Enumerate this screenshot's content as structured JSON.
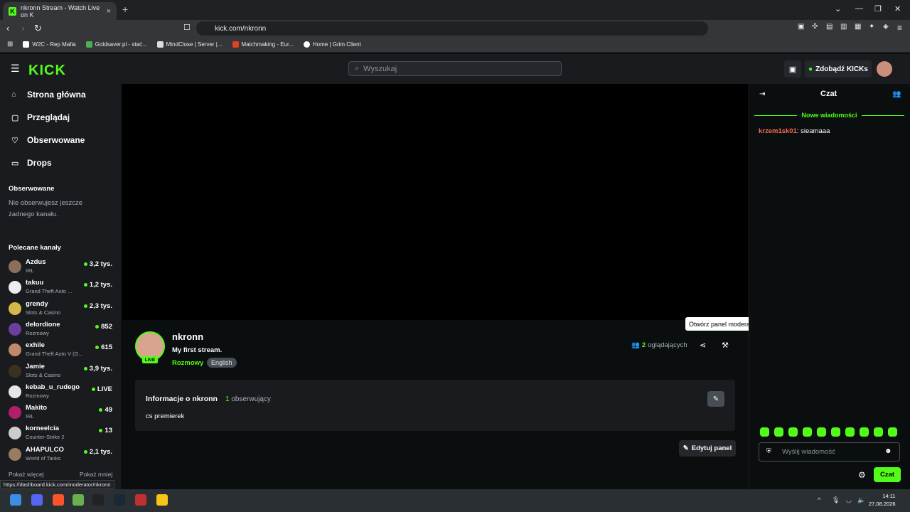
{
  "browser": {
    "tab_title": "nkronn Stream - Watch Live on K",
    "tab_close": "×",
    "new_tab": "+",
    "url": "kick.com/nkronn",
    "bookmarks": [
      "W2C - Rep Mafia",
      "Goldsaver.pl - stać...",
      "MindClose | Server |...",
      "Matchmaking - Eur...",
      "Home | Grim Client"
    ],
    "status_url": "https://dashboard.kick.com/moderator/nkronn"
  },
  "header": {
    "logo": "KICK",
    "search_placeholder": "Wyszukaj",
    "kicks_label": "Zdobądź KICKs"
  },
  "sidebar": {
    "nav": [
      "Strona główna",
      "Przeglądaj",
      "Obserwowane",
      "Drops"
    ],
    "followed_title": "Obserwowane",
    "followed_empty": "Nie obserwujesz jeszcze żadnego kanału.",
    "recommended_title": "Polecane kanały",
    "channels": [
      {
        "name": "Azdus",
        "category": "IRL",
        "viewers": "3,2 tys.",
        "color": "#8a6f5c"
      },
      {
        "name": "takuu",
        "category": "Grand Theft Auto ...",
        "viewers": "1,2 tys.",
        "color": "#eeeeee"
      },
      {
        "name": "grendy",
        "category": "Slots & Casino",
        "viewers": "2,3 tys.",
        "color": "#d4b84a"
      },
      {
        "name": "delordione",
        "category": "Rozmowy",
        "viewers": "852",
        "color": "#6a3fa0"
      },
      {
        "name": "exhile",
        "category": "Grand Theft Auto V (G...",
        "viewers": "615",
        "color": "#c08a6a"
      },
      {
        "name": "Jamie",
        "category": "Slots & Casino",
        "viewers": "3,9 tys.",
        "color": "#3a3220"
      },
      {
        "name": "kebab_u_rudego",
        "category": "Rozmowy",
        "viewers": "LIVE",
        "color": "#e6e6e6"
      },
      {
        "name": "Makito",
        "category": "IRL",
        "viewers": "49",
        "color": "#b0206a"
      },
      {
        "name": "korneelcia",
        "category": "Counter-Strike 2",
        "viewers": "13",
        "color": "#cccccc"
      },
      {
        "name": "AHAPULCO",
        "category": "World of Tanks",
        "viewers": "2,1 tys.",
        "color": "#9a7a60"
      }
    ],
    "show_more": "Pokaż więcej",
    "show_less": "Pokaż mniej"
  },
  "stream": {
    "name": "nkronn",
    "title": "My first stream.",
    "category": "Rozmowy",
    "language": "English",
    "live_badge": "LIVE",
    "viewer_count": "2",
    "viewer_label": "oglądających",
    "tooltip": "Otwórz panel moderacji"
  },
  "about": {
    "title": "Informacje o nkronn",
    "followers_count": "1",
    "followers_label": "obserwujący",
    "description": "cs premierek",
    "edit_panel": "Edytuj panel"
  },
  "chat": {
    "title": "Czat",
    "new_messages": "Nowe wiadomości",
    "messages": [
      {
        "user": "krzem1sk01",
        "text": "sieamaaa"
      }
    ],
    "input_placeholder": "Wyślij wiadomość",
    "send_label": "Czat"
  },
  "taskbar": {
    "time": "14:11",
    "date": "27.08.2026"
  },
  "colors": {
    "accent": "#53fc18",
    "bg": "#0b0e0f",
    "panel": "#191b1f"
  }
}
